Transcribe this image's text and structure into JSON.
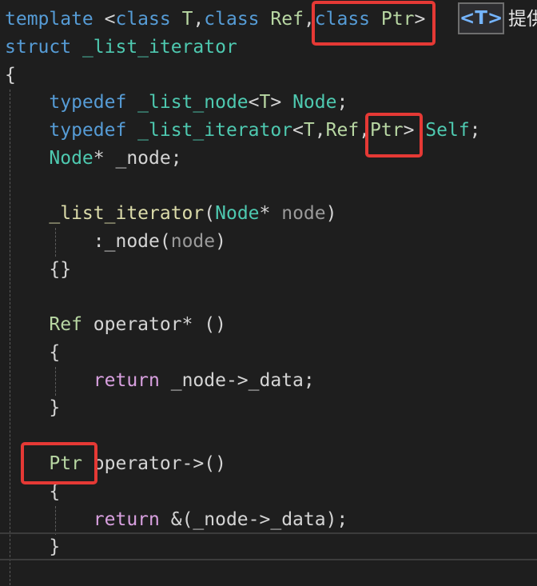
{
  "lines": [
    {
      "id": "l1",
      "tokens": [
        {
          "c": "kw",
          "t": "template "
        },
        {
          "c": "pl",
          "t": "<"
        },
        {
          "c": "kw",
          "t": "class "
        },
        {
          "c": "tp",
          "t": "T"
        },
        {
          "c": "pl",
          "t": ","
        },
        {
          "c": "kw",
          "t": "class "
        },
        {
          "c": "tp",
          "t": "Ref"
        },
        {
          "c": "pl",
          "t": ","
        },
        {
          "c": "kw",
          "t": "class "
        },
        {
          "c": "tp",
          "t": "Ptr"
        },
        {
          "c": "pl",
          "t": ">"
        }
      ]
    },
    {
      "id": "l2",
      "tokens": [
        {
          "c": "kw",
          "t": "struct "
        },
        {
          "c": "ty",
          "t": "_list_iterator"
        }
      ]
    },
    {
      "id": "l3",
      "tokens": [
        {
          "c": "pl",
          "t": "{"
        }
      ]
    },
    {
      "id": "l4",
      "tokens": [
        {
          "c": "pl",
          "t": "    "
        },
        {
          "c": "kw",
          "t": "typedef "
        },
        {
          "c": "ty",
          "t": "_list_node"
        },
        {
          "c": "pl",
          "t": "<"
        },
        {
          "c": "tp",
          "t": "T"
        },
        {
          "c": "pl",
          "t": "> "
        },
        {
          "c": "ty",
          "t": "Node"
        },
        {
          "c": "pl",
          "t": ";"
        }
      ]
    },
    {
      "id": "l5",
      "tokens": [
        {
          "c": "pl",
          "t": "    "
        },
        {
          "c": "kw",
          "t": "typedef "
        },
        {
          "c": "ty",
          "t": "_list_iterator"
        },
        {
          "c": "pl",
          "t": "<"
        },
        {
          "c": "tp",
          "t": "T"
        },
        {
          "c": "pl",
          "t": ","
        },
        {
          "c": "tp",
          "t": "Ref"
        },
        {
          "c": "pl",
          "t": ","
        },
        {
          "c": "tp",
          "t": "Ptr"
        },
        {
          "c": "pl",
          "t": "> "
        },
        {
          "c": "ty",
          "t": "Self"
        },
        {
          "c": "pl",
          "t": ";"
        }
      ]
    },
    {
      "id": "l6",
      "tokens": [
        {
          "c": "pl",
          "t": "    "
        },
        {
          "c": "ty",
          "t": "Node"
        },
        {
          "c": "pl",
          "t": "* _node;"
        }
      ]
    },
    {
      "id": "l8",
      "tokens": [
        {
          "c": "pl",
          "t": "    "
        },
        {
          "c": "fn",
          "t": "_list_iterator"
        },
        {
          "c": "pl",
          "t": "("
        },
        {
          "c": "ty",
          "t": "Node"
        },
        {
          "c": "pl",
          "t": "* "
        },
        {
          "c": "pm",
          "t": "node"
        },
        {
          "c": "pl",
          "t": ")"
        }
      ]
    },
    {
      "id": "l9",
      "tokens": [
        {
          "c": "pl",
          "t": "        :_node("
        },
        {
          "c": "pm",
          "t": "node"
        },
        {
          "c": "pl",
          "t": ")"
        }
      ]
    },
    {
      "id": "l10",
      "tokens": [
        {
          "c": "pl",
          "t": "    {}"
        }
      ]
    },
    {
      "id": "l12",
      "tokens": [
        {
          "c": "pl",
          "t": "    "
        },
        {
          "c": "tp",
          "t": "Ref "
        },
        {
          "c": "pl",
          "t": "operator* ()"
        }
      ]
    },
    {
      "id": "l13",
      "tokens": [
        {
          "c": "pl",
          "t": "    {"
        }
      ]
    },
    {
      "id": "l14",
      "tokens": [
        {
          "c": "pl",
          "t": "        "
        },
        {
          "c": "ret",
          "t": "return "
        },
        {
          "c": "pl",
          "t": "_node->_data;"
        }
      ]
    },
    {
      "id": "l15",
      "tokens": [
        {
          "c": "pl",
          "t": "    }"
        }
      ]
    },
    {
      "id": "l17",
      "tokens": [
        {
          "c": "pl",
          "t": "    "
        },
        {
          "c": "tp",
          "t": "Ptr "
        },
        {
          "c": "pl",
          "t": "operator->()"
        }
      ]
    },
    {
      "id": "l18",
      "tokens": [
        {
          "c": "pl",
          "t": "    {"
        }
      ]
    },
    {
      "id": "l19",
      "tokens": [
        {
          "c": "pl",
          "t": "        "
        },
        {
          "c": "ret",
          "t": "return "
        },
        {
          "c": "pl",
          "t": "&(_node->_data);"
        }
      ]
    },
    {
      "id": "l20",
      "tokens": [
        {
          "c": "pl",
          "t": "    }"
        }
      ]
    }
  ],
  "hint": {
    "tag": "<T>",
    "text": "提供"
  },
  "colors": {
    "background": "#1e1e1e",
    "keyword": "#569cd6",
    "type": "#4ec9b0",
    "template_param": "#b8d7a3",
    "function": "#dcdcaa",
    "return_keyword": "#d8a0df",
    "highlight_box": "#e53935"
  }
}
